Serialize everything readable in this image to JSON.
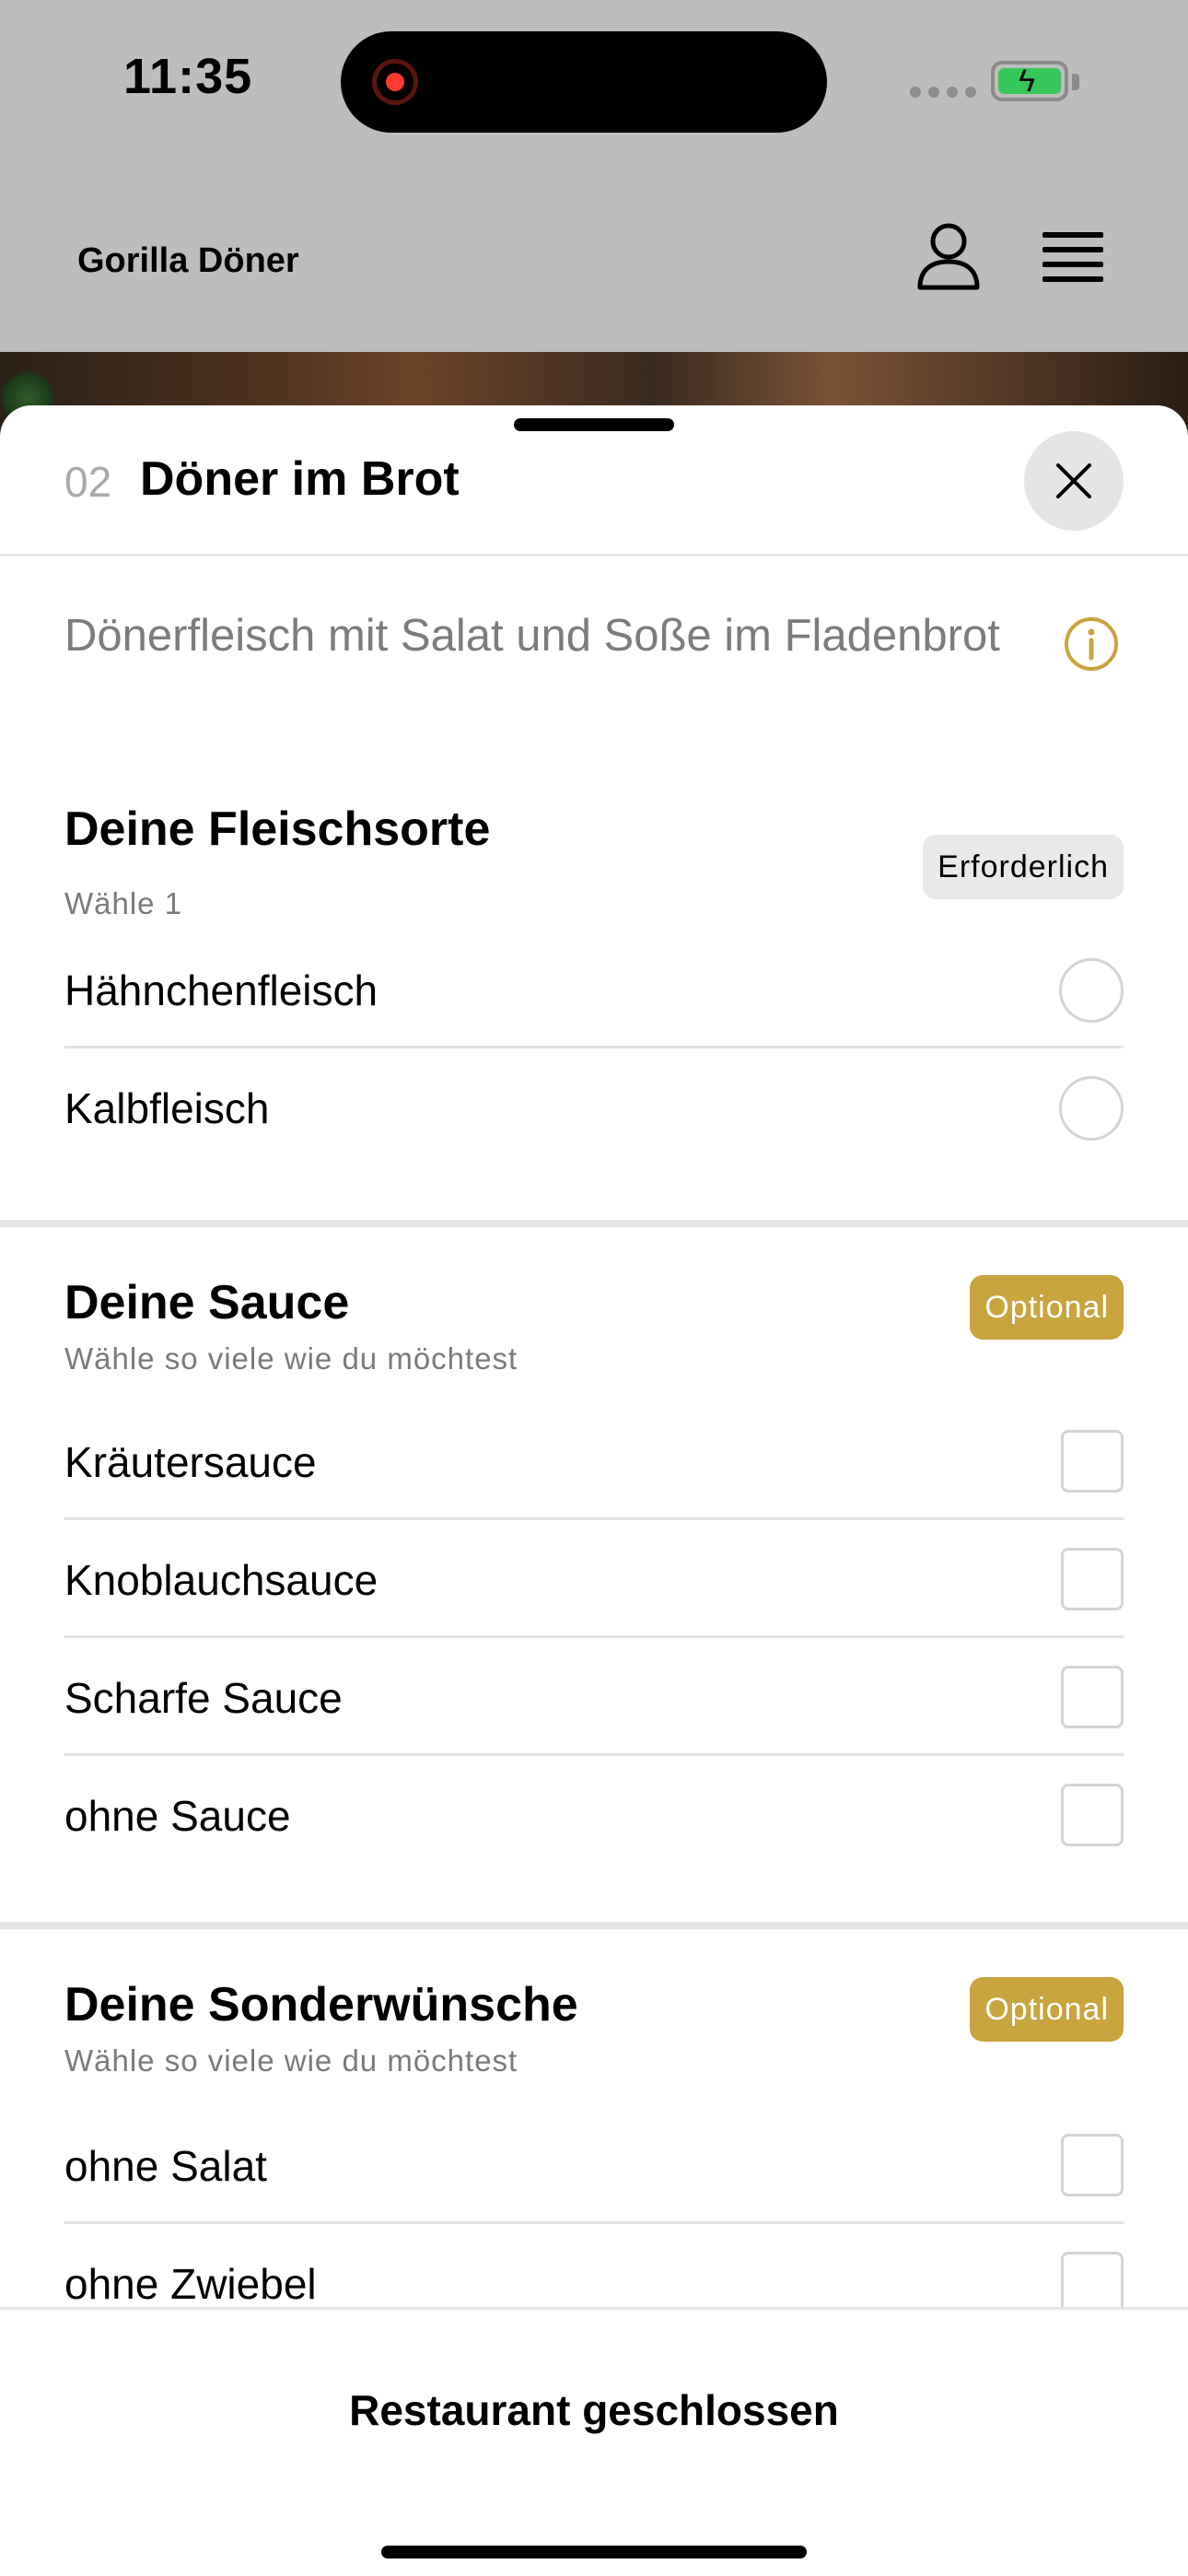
{
  "status_bar": {
    "time": "11:35"
  },
  "header": {
    "brand": "Gorilla Döner"
  },
  "item": {
    "number": "02",
    "title": "Döner im Brot",
    "description": "Dönerfleisch mit Salat und Soße im Fladenbrot"
  },
  "sections": [
    {
      "title": "Deine Fleischsorte",
      "subtitle": "Wähle 1",
      "badge": "Erforderlich",
      "options": [
        "Hähnchenfleisch",
        "Kalbfleisch"
      ]
    },
    {
      "title": "Deine Sauce",
      "subtitle": "Wähle so viele wie du möchtest",
      "badge": "Optional",
      "options": [
        "Kräutersauce",
        "Knoblauchsauce",
        "Scharfe Sauce",
        "ohne Sauce"
      ]
    },
    {
      "title": "Deine Sonderwünsche",
      "subtitle": "Wähle so viele wie du möchtest",
      "badge": "Optional",
      "options": [
        "ohne Salat",
        "ohne Zwiebel"
      ]
    }
  ],
  "footer": {
    "label": "Restaurant geschlossen"
  },
  "colors": {
    "accent": "#c8a43e",
    "battery": "#35c759",
    "record": "#ff3b30"
  }
}
